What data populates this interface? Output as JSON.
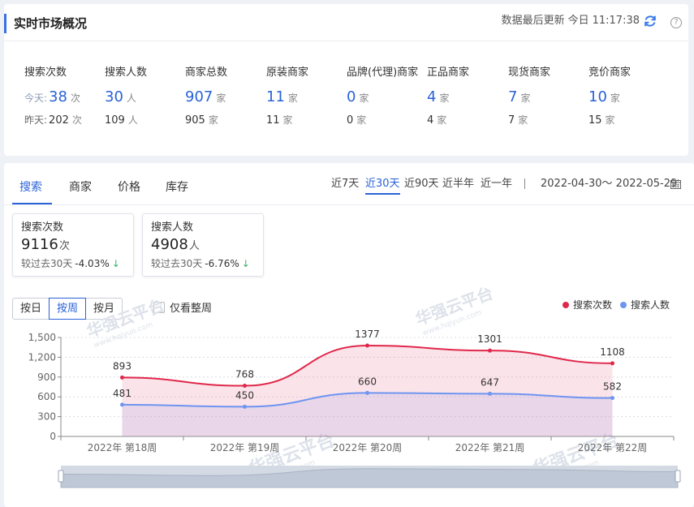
{
  "header": {
    "title": "实时市场概况",
    "update_label": "数据最后更新",
    "update_day": "今日",
    "update_time": "11:17:38",
    "help": "?"
  },
  "metric_labels": {
    "today_prefix": "今天:",
    "yesterday_prefix": "昨天:"
  },
  "metrics": [
    {
      "label": "搜索次数",
      "today": "38",
      "yesterday": "202",
      "unit": "次"
    },
    {
      "label": "搜索人数",
      "today": "30",
      "yesterday": "109",
      "unit": "人"
    },
    {
      "label": "商家总数",
      "today": "907",
      "yesterday": "905",
      "unit": "家"
    },
    {
      "label": "原装商家",
      "today": "11",
      "yesterday": "11",
      "unit": "家"
    },
    {
      "label": "品牌(代理)商家",
      "today": "0",
      "yesterday": "0",
      "unit": "家"
    },
    {
      "label": "正品商家",
      "today": "4",
      "yesterday": "4",
      "unit": "家"
    },
    {
      "label": "现货商家",
      "today": "7",
      "yesterday": "7",
      "unit": "家"
    },
    {
      "label": "竞价商家",
      "today": "10",
      "yesterday": "15",
      "unit": "家"
    }
  ],
  "tabs": [
    "搜索",
    "商家",
    "价格",
    "库存"
  ],
  "active_tab": 0,
  "ranges": [
    "近7天",
    "近30天",
    "近90天",
    "近半年",
    "近一年"
  ],
  "active_range": 1,
  "date_range": "2022-04-30～ 2022-05-29",
  "kpis": [
    {
      "label": "搜索次数",
      "value": "9116",
      "unit": "次",
      "compare_label": "较过去30天",
      "change": "-4.03%"
    },
    {
      "label": "搜索人数",
      "value": "4908",
      "unit": "人",
      "compare_label": "较过去30天",
      "change": "-6.76%"
    }
  ],
  "granularity": [
    "按日",
    "按周",
    "按月"
  ],
  "active_granularity": 1,
  "weekly_only_label": "仅看整周",
  "weekly_only_checked": false,
  "watermark": "华强云平台",
  "watermark_sub": "www.hqiyun.com",
  "colors": {
    "accent": "#2a62d8",
    "series_search_count": "#e0284a",
    "series_search_people": "#6e95f0",
    "down": "#2eb85c"
  },
  "chart_data": {
    "type": "line",
    "x": [
      "2022年 第18周",
      "2022年 第19周",
      "2022年 第20周",
      "2022年 第21周",
      "2022年 第22周"
    ],
    "series": [
      {
        "name": "搜索次数",
        "values": [
          893,
          768,
          1377,
          1301,
          1108
        ]
      },
      {
        "name": "搜索人数",
        "values": [
          481,
          450,
          660,
          647,
          582
        ]
      }
    ],
    "yticks": [
      "0",
      "300",
      "600",
      "900",
      "1,200",
      "1,500"
    ],
    "ylim": [
      0,
      1500
    ],
    "legend_position": "top-right",
    "smooth": true,
    "area_fill": true,
    "grid": true,
    "data_zoom": true
  }
}
